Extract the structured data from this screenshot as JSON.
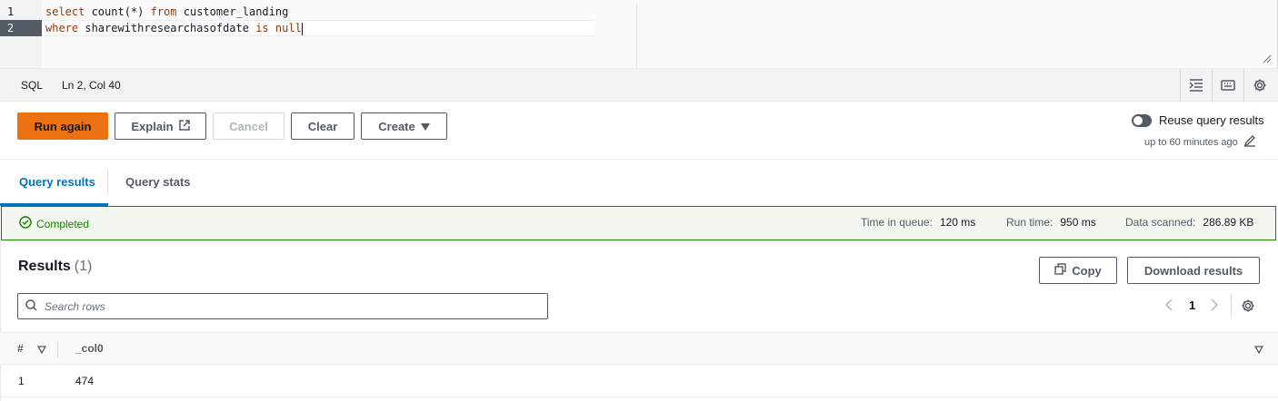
{
  "editor": {
    "line_numbers": [
      "1",
      "2"
    ],
    "line1": {
      "k1": "select",
      "t1": " count(*) ",
      "k2": "from",
      "t2": " customer_landing"
    },
    "line2": {
      "k1": "where",
      "t1": " sharewithresearchasofdate ",
      "k2": "is",
      "t2": " ",
      "k3": "null"
    }
  },
  "statusbar": {
    "language": "SQL",
    "position": "Ln 2, Col 40",
    "icons": [
      "indent-icon",
      "keyboard-icon",
      "settings-icon"
    ]
  },
  "actions": {
    "run_again": "Run again",
    "explain": "Explain",
    "cancel": "Cancel",
    "clear": "Clear",
    "create": "Create",
    "reuse_label": "Reuse query results",
    "reuse_sub": "up to 60 minutes ago"
  },
  "tabs": [
    {
      "label": "Query results",
      "active": true
    },
    {
      "label": "Query stats",
      "active": false
    }
  ],
  "banner": {
    "status": "Completed",
    "time_in_queue_label": "Time in queue:",
    "time_in_queue": "120 ms",
    "run_time_label": "Run time:",
    "run_time": "950 ms",
    "data_scanned_label": "Data scanned:",
    "data_scanned": "286.89 KB"
  },
  "results": {
    "title": "Results",
    "count": "(1)",
    "copy": "Copy",
    "download": "Download results",
    "search_placeholder": "Search rows",
    "page": "1",
    "columns": [
      "#",
      "_col0"
    ],
    "rows": [
      {
        "index": "1",
        "col0": "474"
      }
    ]
  },
  "colors": {
    "primary": "#ec7211",
    "success": "#1d8102",
    "link": "#0073bb",
    "keyword": "#8a3b0c"
  }
}
